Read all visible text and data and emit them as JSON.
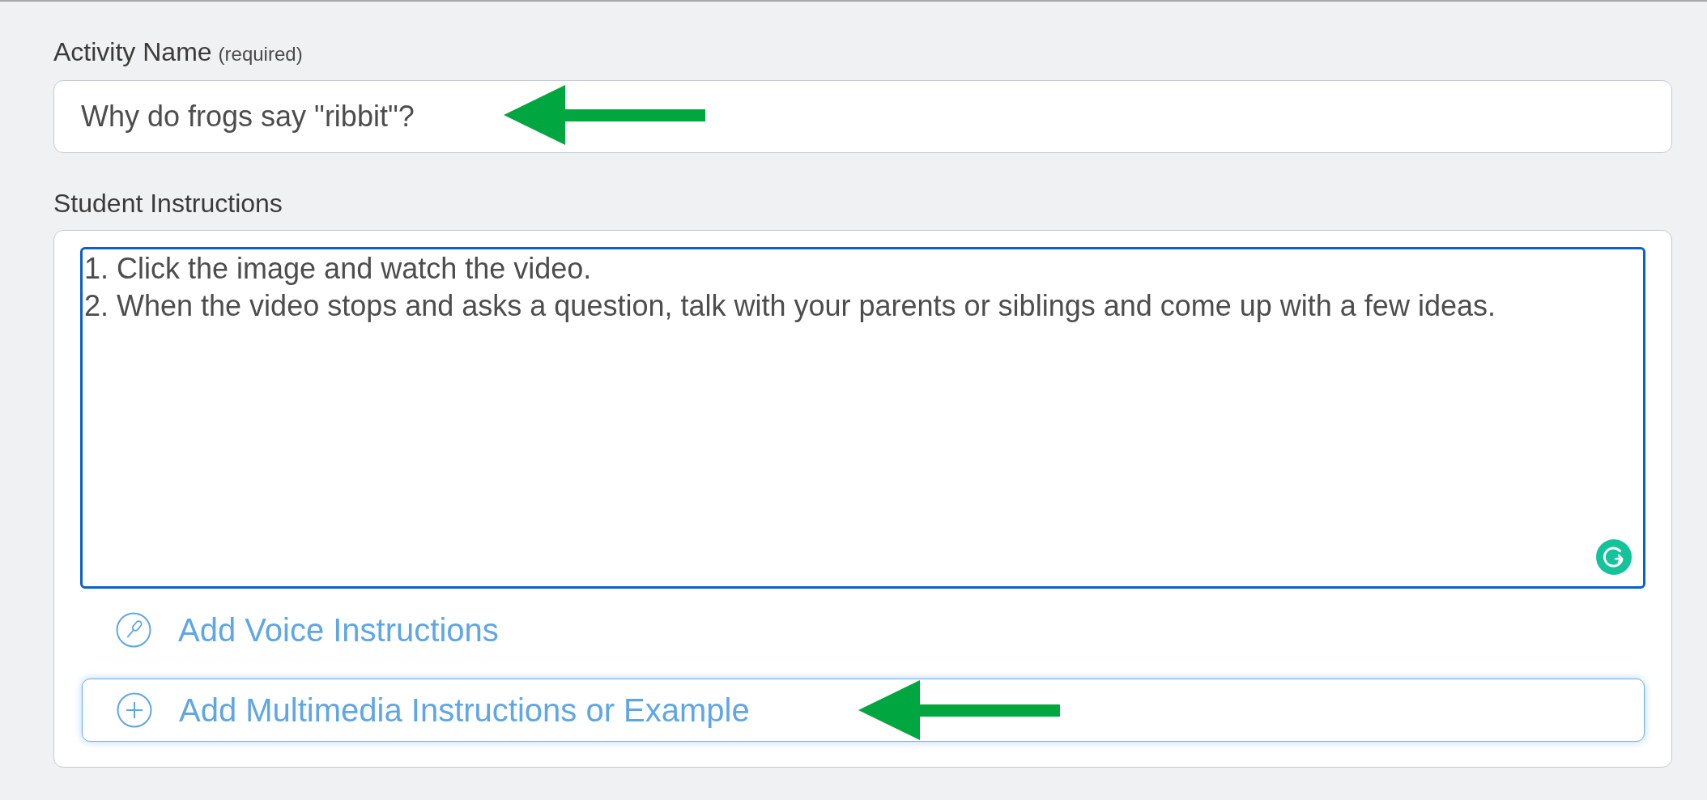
{
  "activity_name": {
    "label": "Activity Name",
    "note": "(required)",
    "value": "Why do frogs say \"ribbit\"?",
    "annotated": true
  },
  "student_instructions": {
    "label": "Student Instructions",
    "focused": true,
    "lines": [
      "1. Click the image and watch the video.",
      "2. When the video stops and asks a question, talk with your parents or siblings and come up with a few ideas."
    ],
    "actions": [
      {
        "kind": "voice",
        "label": "Add Voice Instructions",
        "focused": false,
        "annotated": false
      },
      {
        "kind": "multimedia",
        "label": "Add Multimedia Instructions or Example",
        "focused": true,
        "annotated": true
      }
    ]
  }
}
